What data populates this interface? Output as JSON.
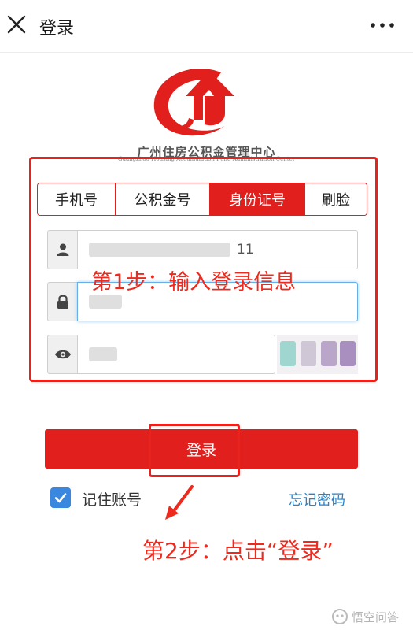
{
  "topbar": {
    "title": "登录",
    "close_icon": "close-icon",
    "more_icon": "more-dots-icon"
  },
  "logo": {
    "org_name": "广州住房公积金管理中心",
    "org_name_en": "Guangzhou Housing Accumulation Fund Administration Center",
    "icon": "housing-fund-logo"
  },
  "tabs": [
    {
      "label": "手机号",
      "active": false
    },
    {
      "label": "公积金号",
      "active": false
    },
    {
      "label": "身份证号",
      "active": true
    },
    {
      "label": "刷脸",
      "active": false
    }
  ],
  "form": {
    "id_field": {
      "icon": "user-icon",
      "visible_value": "11"
    },
    "password_field": {
      "icon": "lock-icon"
    },
    "captcha_field": {
      "icon": "eye-icon"
    }
  },
  "annotations": {
    "step1": "第1步：输入登录信息",
    "step2": "第2步：点击“登录”"
  },
  "login_button": {
    "label": "登录"
  },
  "remember": {
    "label": "记住账号",
    "checked": true
  },
  "forgot": {
    "label": "忘记密码"
  },
  "watermark": {
    "text": "悟空问答"
  },
  "colors": {
    "brand_red": "#e11f1d",
    "annotation_red": "#e8221c",
    "link_blue": "#2a82c8",
    "checkbox_blue": "#3a87e0"
  }
}
